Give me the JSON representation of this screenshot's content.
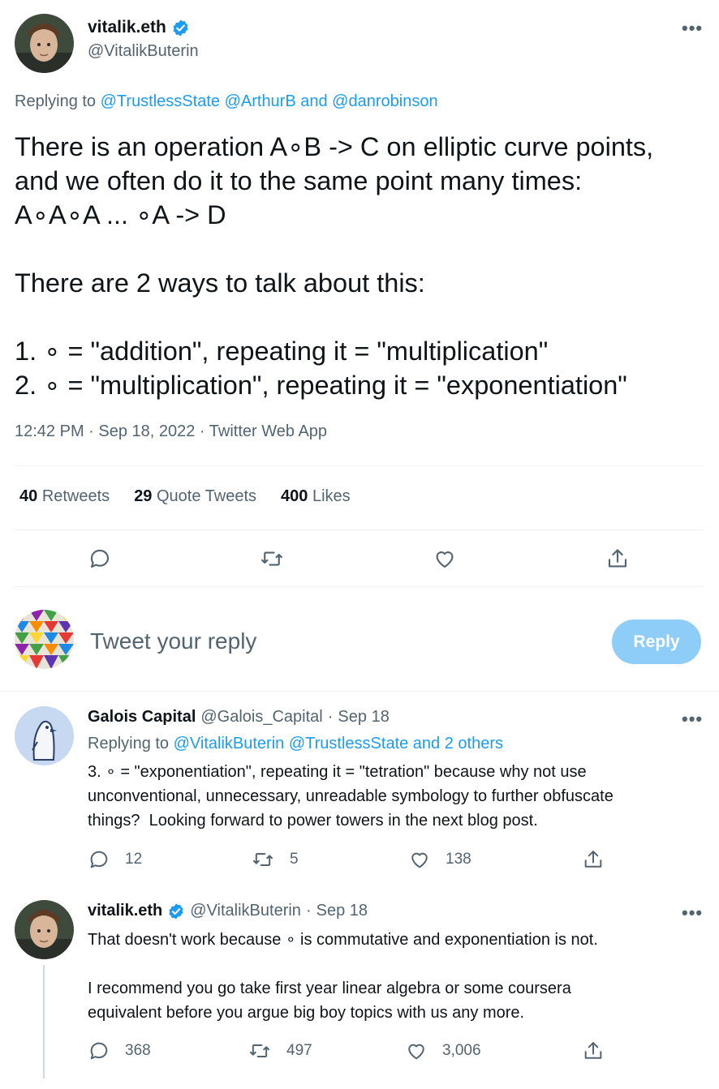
{
  "main_tweet": {
    "display_name": "vitalik.eth",
    "handle": "@VitalikButerin",
    "more_label": "•••",
    "replying_prefix": "Replying to ",
    "replying_user1": "@TrustlessState",
    "replying_user2": "@ArthurB",
    "replying_and": " and ",
    "replying_user3": "@danrobinson",
    "text": "There is an operation A∘B -> C on elliptic curve points,\nand we often do it to the same point many times:\nA∘A∘A ... ∘A -> D\n\nThere are 2 ways to talk about this:\n\n1. ∘ = \"addition\", repeating it = \"multiplication\"\n2. ∘ = \"multiplication\", repeating it = \"exponentiation\"",
    "timestamp": "12:42 PM · Sep 18, 2022 · Twitter Web App",
    "stats": {
      "retweets_count": "40",
      "retweets_label": "Retweets",
      "quotes_count": "29",
      "quotes_label": "Quote Tweets",
      "likes_count": "400",
      "likes_label": "Likes"
    }
  },
  "reply_box": {
    "placeholder": "Tweet your reply",
    "button_label": "Reply"
  },
  "replies": [
    {
      "display_name": "Galois Capital",
      "handle": "@Galois_Capital",
      "dot": "·",
      "date": "Sep 18",
      "replying_prefix": "Replying to ",
      "replying_user1": "@VitalikButerin",
      "replying_user2": "@TrustlessState",
      "replying_and": " and ",
      "replying_others": "2 others",
      "text": "3. ∘ = \"exponentiation\", repeating it = \"tetration\" because why not use\nunconventional, unnecessary, unreadable symbology to further obfuscate\nthings?  Looking forward to power towers in the next blog post.",
      "reply_count": "12",
      "retweet_count": "5",
      "like_count": "138"
    },
    {
      "display_name": "vitalik.eth",
      "handle": "@VitalikButerin",
      "dot": "·",
      "date": "Sep 18",
      "text": "That doesn't work because ∘ is commutative and exponentiation is not.\n\nI recommend you go take first year linear algebra or some coursera\nequivalent before you argue big boy topics with us any more.",
      "reply_count": "368",
      "retweet_count": "497",
      "like_count": "3,006"
    }
  ],
  "colors": {
    "accent": "#1d9bf0",
    "muted": "#536471",
    "reply_button_disabled": "#8ecdf8",
    "divider": "#eff3f4"
  },
  "icons": [
    "verified-badge-icon",
    "more-icon",
    "reply-icon",
    "retweet-icon",
    "like-icon",
    "share-icon"
  ]
}
